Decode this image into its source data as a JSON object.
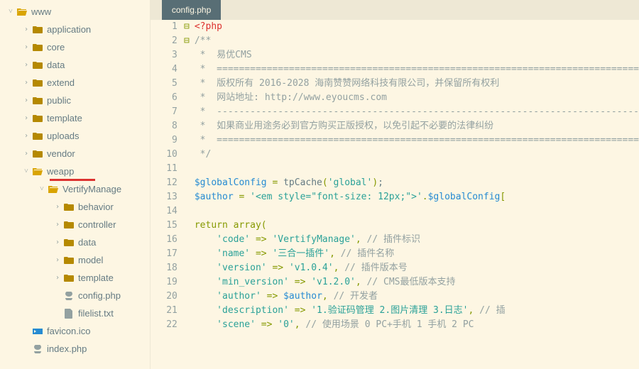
{
  "tree": {
    "root": "www",
    "items": [
      {
        "name": "application",
        "type": "folder",
        "depth": 1,
        "arrow": ">"
      },
      {
        "name": "core",
        "type": "folder",
        "depth": 1,
        "arrow": ">"
      },
      {
        "name": "data",
        "type": "folder",
        "depth": 1,
        "arrow": ">"
      },
      {
        "name": "extend",
        "type": "folder",
        "depth": 1,
        "arrow": ">"
      },
      {
        "name": "public",
        "type": "folder",
        "depth": 1,
        "arrow": ">"
      },
      {
        "name": "template",
        "type": "folder",
        "depth": 1,
        "arrow": ">"
      },
      {
        "name": "uploads",
        "type": "folder",
        "depth": 1,
        "arrow": ">"
      },
      {
        "name": "vendor",
        "type": "folder",
        "depth": 1,
        "arrow": ">"
      },
      {
        "name": "weapp",
        "type": "folder-open",
        "depth": 1,
        "arrow": "v",
        "redline": true
      },
      {
        "name": "VertifyManage",
        "type": "folder-open",
        "depth": 2,
        "arrow": "v"
      },
      {
        "name": "behavior",
        "type": "folder",
        "depth": 3,
        "arrow": ">"
      },
      {
        "name": "controller",
        "type": "folder",
        "depth": 3,
        "arrow": ">"
      },
      {
        "name": "data",
        "type": "folder",
        "depth": 3,
        "arrow": ">"
      },
      {
        "name": "model",
        "type": "folder",
        "depth": 3,
        "arrow": ">"
      },
      {
        "name": "template",
        "type": "folder",
        "depth": 3,
        "arrow": ">"
      },
      {
        "name": "config.php",
        "type": "php",
        "depth": 3,
        "arrow": ""
      },
      {
        "name": "filelist.txt",
        "type": "file",
        "depth": 3,
        "arrow": ""
      },
      {
        "name": "favicon.ico",
        "type": "ico",
        "depth": 1,
        "arrow": ""
      },
      {
        "name": "index.php",
        "type": "php",
        "depth": 1,
        "arrow": ""
      }
    ]
  },
  "tab": {
    "active": "config.php"
  },
  "code": {
    "lines": [
      {
        "n": 1,
        "fold": "-",
        "tokens": [
          [
            "code-red",
            "<?php"
          ]
        ]
      },
      {
        "n": 2,
        "fold": "-",
        "tokens": [
          [
            "code-gray",
            "/**"
          ]
        ]
      },
      {
        "n": 3,
        "tokens": [
          [
            "code-gray",
            " *  易优CMS"
          ]
        ]
      },
      {
        "n": 4,
        "tokens": [
          [
            "code-gray",
            " *  ============================================================================"
          ]
        ]
      },
      {
        "n": 5,
        "tokens": [
          [
            "code-gray",
            " *  版权所有 2016-2028 海南赞赞网络科技有限公司，并保留所有权利"
          ]
        ]
      },
      {
        "n": 6,
        "tokens": [
          [
            "code-gray",
            " *  网站地址: http://www.eyoucms.com"
          ]
        ]
      },
      {
        "n": 7,
        "tokens": [
          [
            "code-gray",
            " *  ----------------------------------------------------------------------------"
          ]
        ]
      },
      {
        "n": 8,
        "tokens": [
          [
            "code-gray",
            " *  如果商业用途务必到官方购买正版授权，以免引起不必要的法律纠纷"
          ]
        ]
      },
      {
        "n": 9,
        "tokens": [
          [
            "code-gray",
            " *  ============================================================================"
          ]
        ]
      },
      {
        "n": 10,
        "tokens": [
          [
            "code-gray",
            " */"
          ]
        ]
      },
      {
        "n": 11,
        "tokens": [
          [
            "code-text",
            ""
          ]
        ]
      },
      {
        "n": 12,
        "tokens": [
          [
            "code-blue",
            "$globalConfig"
          ],
          [
            "code-text",
            " "
          ],
          [
            "code-green",
            "="
          ],
          [
            "code-text",
            " tpCache"
          ],
          [
            "code-green",
            "("
          ],
          [
            "code-cyan",
            "'global'"
          ],
          [
            "code-green",
            ")"
          ],
          [
            "code-text",
            ";"
          ]
        ]
      },
      {
        "n": 13,
        "tokens": [
          [
            "code-blue",
            "$author"
          ],
          [
            "code-text",
            " "
          ],
          [
            "code-green",
            "="
          ],
          [
            "code-text",
            " "
          ],
          [
            "code-cyan",
            "'<em style=\"font-size: 12px;\">'"
          ],
          [
            "code-green",
            "."
          ],
          [
            "code-blue",
            "$globalConfig"
          ],
          [
            "code-green",
            "["
          ]
        ]
      },
      {
        "n": 14,
        "tokens": [
          [
            "code-text",
            ""
          ]
        ]
      },
      {
        "n": 15,
        "tokens": [
          [
            "code-green",
            "return"
          ],
          [
            "code-text",
            " "
          ],
          [
            "code-green",
            "array"
          ],
          [
            "code-green",
            "("
          ]
        ]
      },
      {
        "n": 16,
        "tokens": [
          [
            "code-text",
            "    "
          ],
          [
            "code-cyan",
            "'code'"
          ],
          [
            "code-text",
            " "
          ],
          [
            "code-green",
            "=>"
          ],
          [
            "code-text",
            " "
          ],
          [
            "code-cyan",
            "'VertifyManage'"
          ],
          [
            "code-green",
            ","
          ],
          [
            "code-text",
            " "
          ],
          [
            "code-gray",
            "// 插件标识"
          ]
        ]
      },
      {
        "n": 17,
        "tokens": [
          [
            "code-text",
            "    "
          ],
          [
            "code-cyan",
            "'name'"
          ],
          [
            "code-text",
            " "
          ],
          [
            "code-green",
            "=>"
          ],
          [
            "code-text",
            " "
          ],
          [
            "code-cyan",
            "'三合一插件'"
          ],
          [
            "code-green",
            ","
          ],
          [
            "code-text",
            " "
          ],
          [
            "code-gray",
            "// 插件名称"
          ]
        ]
      },
      {
        "n": 18,
        "tokens": [
          [
            "code-text",
            "    "
          ],
          [
            "code-cyan",
            "'version'"
          ],
          [
            "code-text",
            " "
          ],
          [
            "code-green",
            "=>"
          ],
          [
            "code-text",
            " "
          ],
          [
            "code-cyan",
            "'v1.0.4'"
          ],
          [
            "code-green",
            ","
          ],
          [
            "code-text",
            " "
          ],
          [
            "code-gray",
            "// 插件版本号"
          ]
        ]
      },
      {
        "n": 19,
        "tokens": [
          [
            "code-text",
            "    "
          ],
          [
            "code-cyan",
            "'min_version'"
          ],
          [
            "code-text",
            " "
          ],
          [
            "code-green",
            "=>"
          ],
          [
            "code-text",
            " "
          ],
          [
            "code-cyan",
            "'v1.2.0'"
          ],
          [
            "code-green",
            ","
          ],
          [
            "code-text",
            " "
          ],
          [
            "code-gray",
            "// CMS最低版本支持"
          ]
        ]
      },
      {
        "n": 20,
        "tokens": [
          [
            "code-text",
            "    "
          ],
          [
            "code-cyan",
            "'author'"
          ],
          [
            "code-text",
            " "
          ],
          [
            "code-green",
            "=>"
          ],
          [
            "code-text",
            " "
          ],
          [
            "code-blue",
            "$author"
          ],
          [
            "code-green",
            ","
          ],
          [
            "code-text",
            " "
          ],
          [
            "code-gray",
            "// 开发者"
          ]
        ]
      },
      {
        "n": 21,
        "tokens": [
          [
            "code-text",
            "    "
          ],
          [
            "code-cyan",
            "'description'"
          ],
          [
            "code-text",
            " "
          ],
          [
            "code-green",
            "=>"
          ],
          [
            "code-text",
            " "
          ],
          [
            "code-cyan",
            "'1.验证码管理 2.图片清理 3.日志'"
          ],
          [
            "code-green",
            ","
          ],
          [
            "code-text",
            " "
          ],
          [
            "code-gray",
            "// 插"
          ]
        ]
      },
      {
        "n": 22,
        "tokens": [
          [
            "code-text",
            "    "
          ],
          [
            "code-cyan",
            "'scene'"
          ],
          [
            "code-text",
            " "
          ],
          [
            "code-green",
            "=>"
          ],
          [
            "code-text",
            " "
          ],
          [
            "code-cyan",
            "'0'"
          ],
          [
            "code-green",
            ","
          ],
          [
            "code-text",
            " "
          ],
          [
            "code-gray",
            "// 使用场景 0 PC+手机 1 手机 2 PC"
          ]
        ]
      }
    ]
  }
}
